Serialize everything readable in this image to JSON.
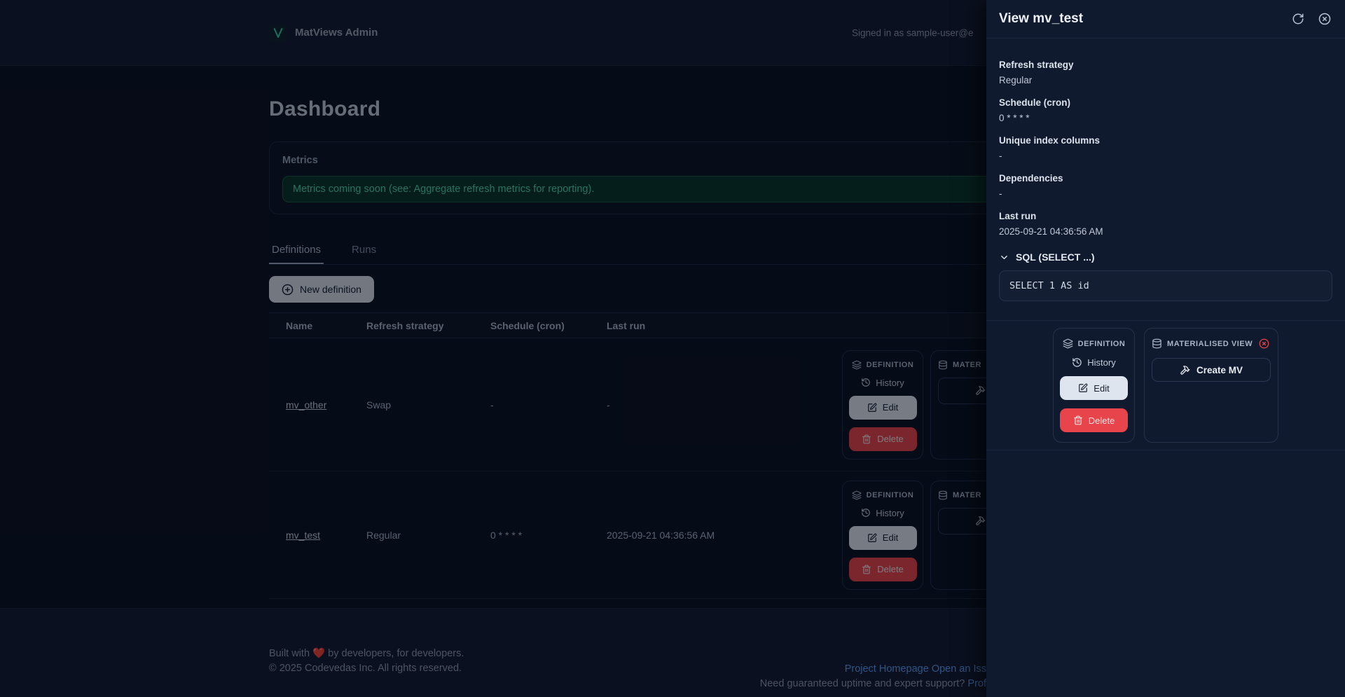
{
  "header": {
    "brand": "MatViews Admin",
    "signed_in": "Signed in as sample-user@e"
  },
  "page": {
    "title": "Dashboard"
  },
  "metrics": {
    "title": "Metrics",
    "banner": "Metrics coming soon (see: Aggregate refresh metrics for reporting)."
  },
  "tabs": [
    {
      "label": "Definitions",
      "active": true
    },
    {
      "label": "Runs",
      "active": false
    }
  ],
  "toolbar": {
    "new_definition": "New definition"
  },
  "table": {
    "columns": [
      "Name",
      "Refresh strategy",
      "Schedule (cron)",
      "Last run"
    ],
    "rows": [
      {
        "name": "mv_other",
        "refresh_strategy": "Swap",
        "schedule": "-",
        "last_run": "-"
      },
      {
        "name": "mv_test",
        "refresh_strategy": "Regular",
        "schedule": "0 * * * *",
        "last_run": "2025-09-21 04:36:56 AM"
      }
    ],
    "row_actions": {
      "definition_title": "DEFINITION",
      "materialised_title": "MATER",
      "history": "History",
      "edit": "Edit",
      "delete": "Delete"
    }
  },
  "panel": {
    "title": "View mv_test",
    "fields": [
      {
        "label": "Refresh strategy",
        "value": "Regular"
      },
      {
        "label": "Schedule (cron)",
        "value": "0 * * * *"
      },
      {
        "label": "Unique index columns",
        "value": "-"
      },
      {
        "label": "Dependencies",
        "value": "-"
      },
      {
        "label": "Last run",
        "value": "2025-09-21 04:36:56 AM"
      }
    ],
    "sql_section": {
      "title": "SQL (SELECT ...)",
      "code": "SELECT 1 AS id"
    },
    "definition_card": {
      "title": "DEFINITION",
      "history": "History",
      "edit": "Edit",
      "delete": "Delete"
    },
    "mv_card": {
      "title": "MATERIALISED VIEW",
      "create": "Create MV"
    }
  },
  "footer": {
    "built_prefix": "Built with",
    "heart": "❤️",
    "built_suffix": "by developers, for developers.",
    "copyright": "© 2025 Codevedas Inc. All rights reserved.",
    "link_homepage": "Project Homepage",
    "link_issue": "Open an Iss",
    "support_text": "Need guaranteed uptime and expert support?",
    "support_link": "Prof"
  },
  "colors": {
    "brand_green": "#2fd4a0",
    "danger_red": "#e8444b",
    "link_blue": "#5b9bf0",
    "banner_green_bg": "#0a3528",
    "banner_green_text": "#4fd6a6",
    "panel_bg": "#101a2e"
  }
}
